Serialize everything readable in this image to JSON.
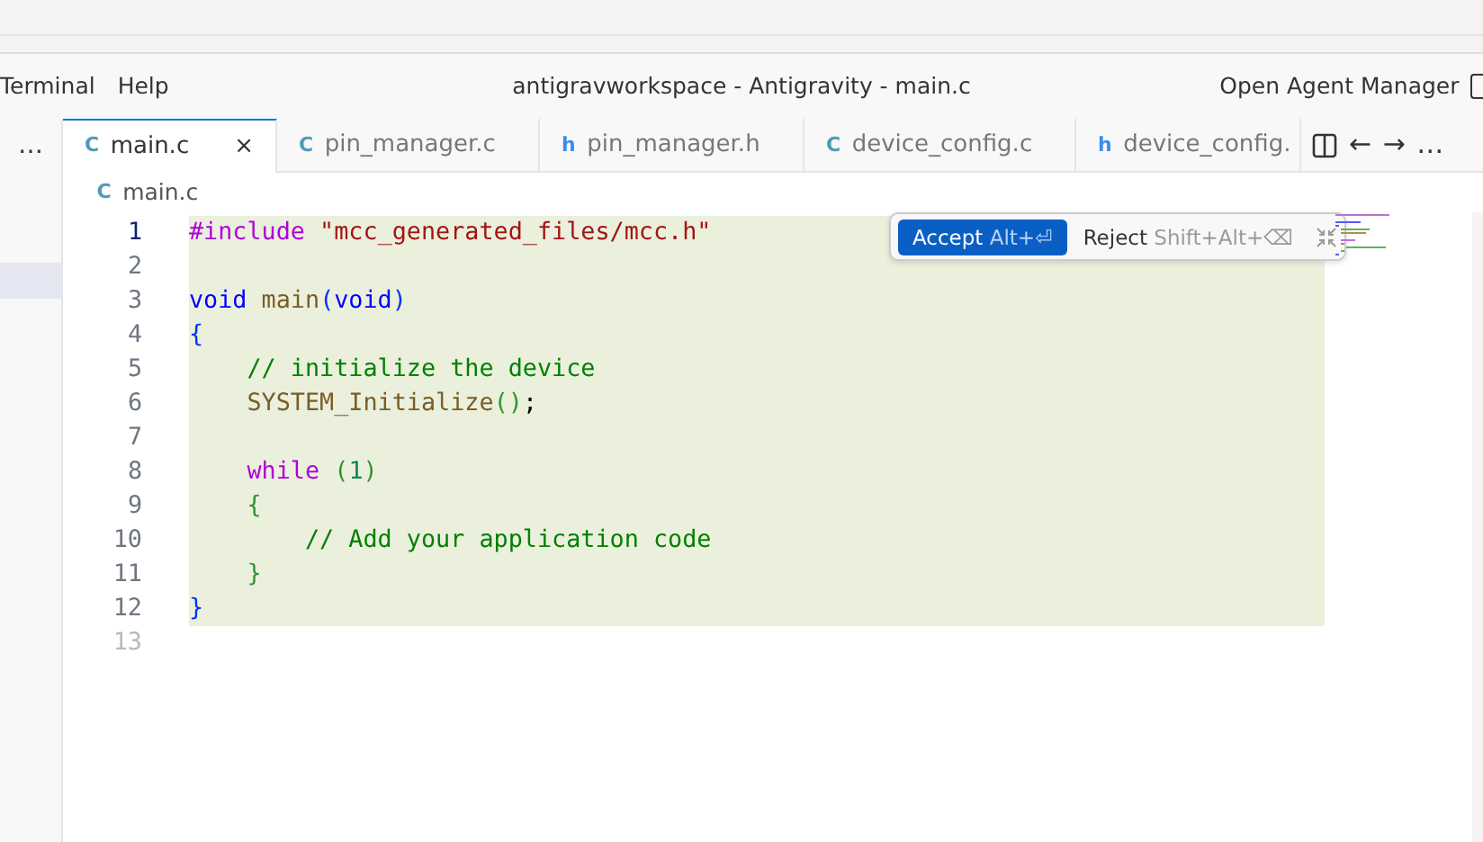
{
  "menu": [
    {
      "label": "Terminal"
    },
    {
      "label": "Help"
    }
  ],
  "window": {
    "title": "antigravworkspace - Antigravity - main.c",
    "agent_button": "Open Agent Manager"
  },
  "sidebar": {
    "more": "…",
    "items": [
      {
        "selected": true
      }
    ]
  },
  "tabs": [
    {
      "icon": "C",
      "label": "main.c",
      "selected": true,
      "close": "×"
    },
    {
      "icon": "C",
      "label": "pin_manager.c",
      "selected": false
    },
    {
      "icon": "h",
      "label": "pin_manager.h",
      "selected": false
    },
    {
      "icon": "C",
      "label": "device_config.c",
      "selected": false
    },
    {
      "icon": "h",
      "label": "device_config.",
      "selected": false
    }
  ],
  "tab_actions": [
    "←",
    "→",
    "…"
  ],
  "breadcrumb": {
    "icon": "C",
    "label": "main.c"
  },
  "lines": [
    {
      "number": "1",
      "selected": true,
      "added": true,
      "tokens": [
        {
          "kind": "directive",
          "text": "#include"
        },
        {
          "kind": "string",
          "text": " \"mcc_generated_files/mcc.h\""
        }
      ]
    },
    {
      "number": "2",
      "selected": false,
      "added": true
    },
    {
      "number": "3",
      "selected": false,
      "added": true,
      "tokens": [
        {
          "kind": "keyword",
          "text": "void"
        },
        {
          "kind": "function",
          "text": " main"
        },
        {
          "kind": "bracket1",
          "text": "("
        },
        {
          "kind": "keyword",
          "text": "void"
        },
        {
          "kind": "bracket1",
          "text": ")"
        }
      ]
    },
    {
      "number": "4",
      "selected": false,
      "added": true,
      "tokens": [
        {
          "kind": "bracket1",
          "text": "{"
        }
      ]
    },
    {
      "number": "5",
      "selected": false,
      "added": true,
      "tokens": [
        {
          "kind": "comment",
          "text": "    // initialize the device"
        }
      ]
    },
    {
      "number": "6",
      "selected": false,
      "added": true,
      "tokens": [
        {
          "kind": "function",
          "text": "    SYSTEM_Initialize"
        },
        {
          "kind": "bracket2",
          "text": "()"
        },
        {
          "kind": "plain",
          "text": ";"
        }
      ]
    },
    {
      "number": "7",
      "selected": false,
      "added": true
    },
    {
      "number": "8",
      "selected": false,
      "added": true,
      "tokens": [
        {
          "kind": "control",
          "text": "    while"
        },
        {
          "kind": "bracket2",
          "text": " ("
        },
        {
          "kind": "number",
          "text": "1"
        },
        {
          "kind": "bracket2",
          "text": ")"
        }
      ]
    },
    {
      "number": "9",
      "selected": false,
      "added": true,
      "tokens": [
        {
          "kind": "bracket2",
          "text": "    {"
        }
      ]
    },
    {
      "number": "10",
      "selected": false,
      "added": true,
      "tokens": [
        {
          "kind": "comment",
          "text": "        // Add your application code"
        }
      ]
    },
    {
      "number": "11",
      "selected": false,
      "added": true,
      "tokens": [
        {
          "kind": "bracket2",
          "text": "    }"
        }
      ]
    },
    {
      "number": "12",
      "selected": false,
      "added": true,
      "tokens": [
        {
          "kind": "bracket1",
          "text": "}"
        }
      ]
    },
    {
      "number": "13",
      "selected": false,
      "added": false
    }
  ],
  "diff_bar": {
    "accept": "Accept",
    "accept_shortcut": "Alt+⏎",
    "reject": "Reject",
    "reject_shortcut": "Shift+Alt+⌫"
  }
}
